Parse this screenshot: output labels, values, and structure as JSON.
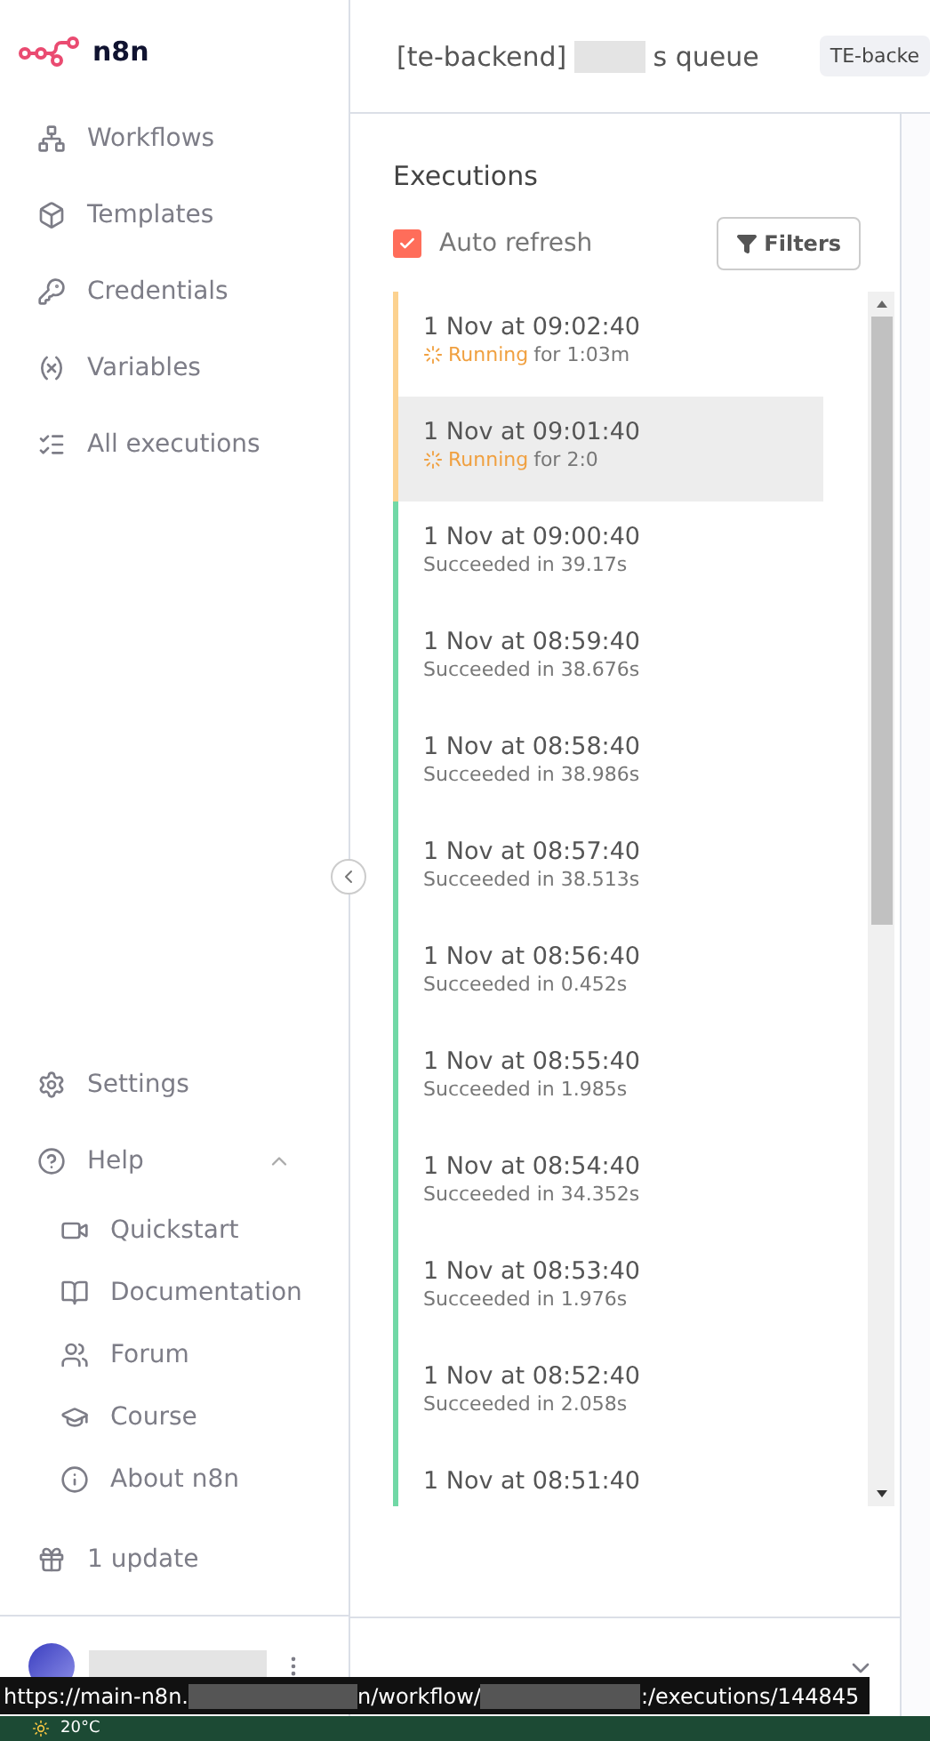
{
  "logo": {
    "text": "n8n"
  },
  "nav": [
    {
      "label": "Workflows"
    },
    {
      "label": "Templates"
    },
    {
      "label": "Credentials"
    },
    {
      "label": "Variables"
    },
    {
      "label": "All executions"
    }
  ],
  "bottom_nav": [
    {
      "label": "Settings"
    }
  ],
  "help": {
    "label": "Help",
    "expanded": true,
    "children": [
      {
        "label": "Quickstart"
      },
      {
        "label": "Documentation"
      },
      {
        "label": "Forum"
      },
      {
        "label": "Course"
      },
      {
        "label": "About n8n"
      }
    ]
  },
  "update": {
    "label": "1 update"
  },
  "header": {
    "title_start": "[te-backend]",
    "title_end": "s queue",
    "tag": "TE-backe"
  },
  "executions": {
    "title": "Executions",
    "auto_refresh": {
      "label": "Auto refresh",
      "checked": true
    },
    "filters": "Filters",
    "items": [
      {
        "time": "1 Nov at 09:02:40",
        "kind": "running",
        "status_text": "Running",
        "detail": "for 1:03m",
        "selected": false
      },
      {
        "time": "1 Nov at 09:01:40",
        "kind": "running",
        "status_text": "Running",
        "detail": "for 2:0",
        "selected": true
      },
      {
        "time": "1 Nov at 09:00:40",
        "kind": "success",
        "status_text": "Succeeded in 39.17s",
        "selected": false
      },
      {
        "time": "1 Nov at 08:59:40",
        "kind": "success",
        "status_text": "Succeeded in 38.676s",
        "selected": false
      },
      {
        "time": "1 Nov at 08:58:40",
        "kind": "success",
        "status_text": "Succeeded in 38.986s",
        "selected": false
      },
      {
        "time": "1 Nov at 08:57:40",
        "kind": "success",
        "status_text": "Succeeded in 38.513s",
        "selected": false
      },
      {
        "time": "1 Nov at 08:56:40",
        "kind": "success",
        "status_text": "Succeeded in 0.452s",
        "selected": false
      },
      {
        "time": "1 Nov at 08:55:40",
        "kind": "success",
        "status_text": "Succeeded in 1.985s",
        "selected": false
      },
      {
        "time": "1 Nov at 08:54:40",
        "kind": "success",
        "status_text": "Succeeded in 34.352s",
        "selected": false
      },
      {
        "time": "1 Nov at 08:53:40",
        "kind": "success",
        "status_text": "Succeeded in 1.976s",
        "selected": false
      },
      {
        "time": "1 Nov at 08:52:40",
        "kind": "success",
        "status_text": "Succeeded in 2.058s",
        "selected": false
      },
      {
        "time": "1 Nov at 08:51:40",
        "kind": "success",
        "selected": false
      }
    ]
  },
  "link_preview": {
    "parts": [
      "https://main-n8n.",
      "n/workflow/",
      ":/executions/144845"
    ]
  },
  "taskbar": {
    "weather": "20°C"
  }
}
